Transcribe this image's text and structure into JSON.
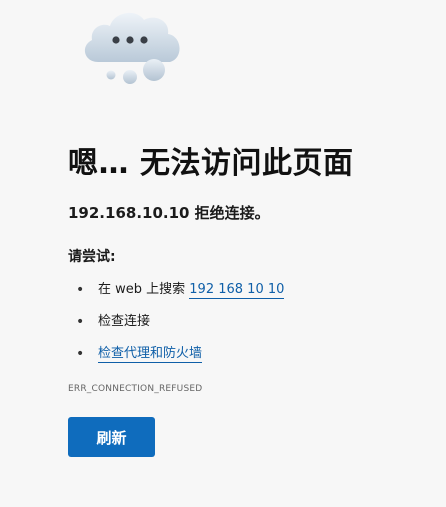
{
  "error_page": {
    "headline": "嗯… 无法访问此页面",
    "subtitle": "192.168.10.10 拒绝连接。",
    "try_label": "请尝试:",
    "suggestions": [
      {
        "prefix": "在 web 上搜索 ",
        "link": "192 168 10 10"
      },
      {
        "text": "检查连接"
      },
      {
        "link": "检查代理和防火墙"
      }
    ],
    "error_code": "ERR_CONNECTION_REFUSED",
    "refresh_label": "刷新"
  },
  "icons": {
    "illustration": "cloud-with-dots-icon"
  },
  "colors": {
    "background": "#f7f7f7",
    "link": "#0f5fa8",
    "button": "#0f6cbd",
    "button_text": "#ffffff"
  }
}
